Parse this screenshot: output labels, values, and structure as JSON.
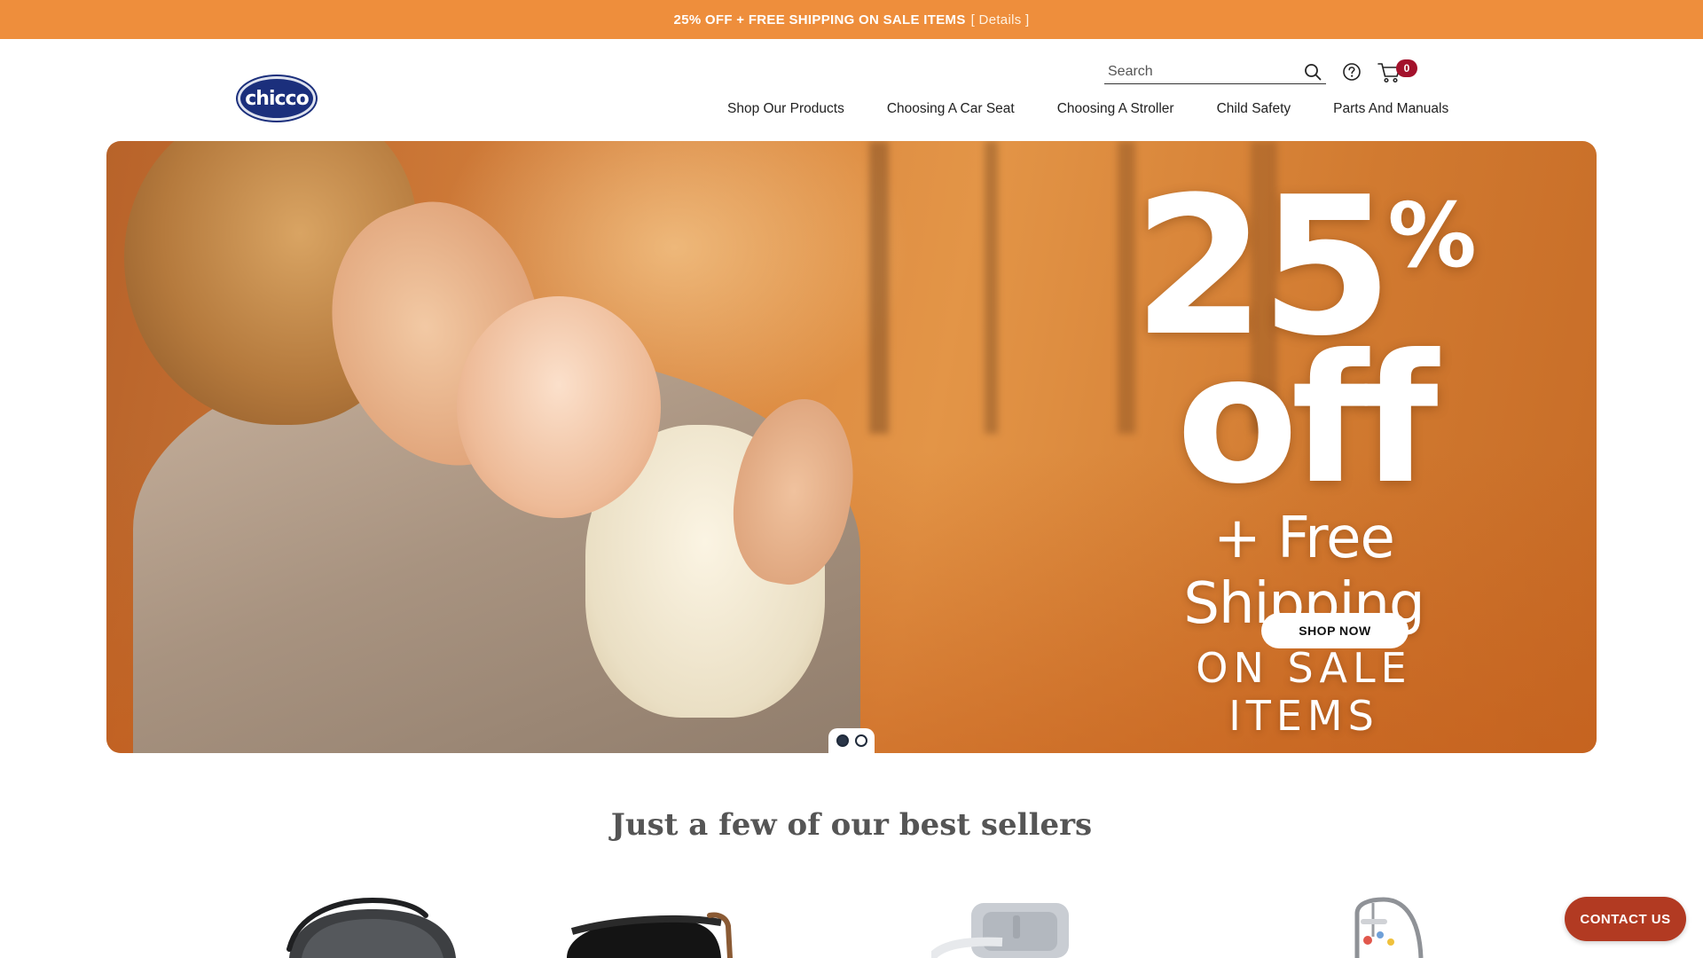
{
  "promo": {
    "text": "25% OFF + FREE SHIPPING ON SALE ITEMS",
    "details_link": "[ Details ]"
  },
  "header": {
    "logo_text": "chicco",
    "search": {
      "placeholder": "Search",
      "value": ""
    },
    "cart_count": "0",
    "icons": [
      "search-icon",
      "help-icon",
      "cart-icon"
    ]
  },
  "nav": {
    "items": [
      {
        "label": "Shop Our Products"
      },
      {
        "label": "Choosing A Car Seat"
      },
      {
        "label": "Choosing A Stroller"
      },
      {
        "label": "Child Safety"
      },
      {
        "label": "Parts And Manuals"
      }
    ]
  },
  "hero": {
    "big_number": "25",
    "percent": "%",
    "off": "off",
    "shipping": "+ Free Shipping",
    "sale": "ON SALE ITEMS",
    "cta": "SHOP NOW",
    "slides": 2,
    "active_slide": 1
  },
  "best_sellers": {
    "title": "Just a few of our best sellers"
  },
  "contact": {
    "label": "CONTACT US"
  },
  "colors": {
    "promo_bar": "#ee8e3c",
    "cart_badge": "#a3112b",
    "contact_button": "#b23a22",
    "logo_blue": "#1b2f7c"
  }
}
